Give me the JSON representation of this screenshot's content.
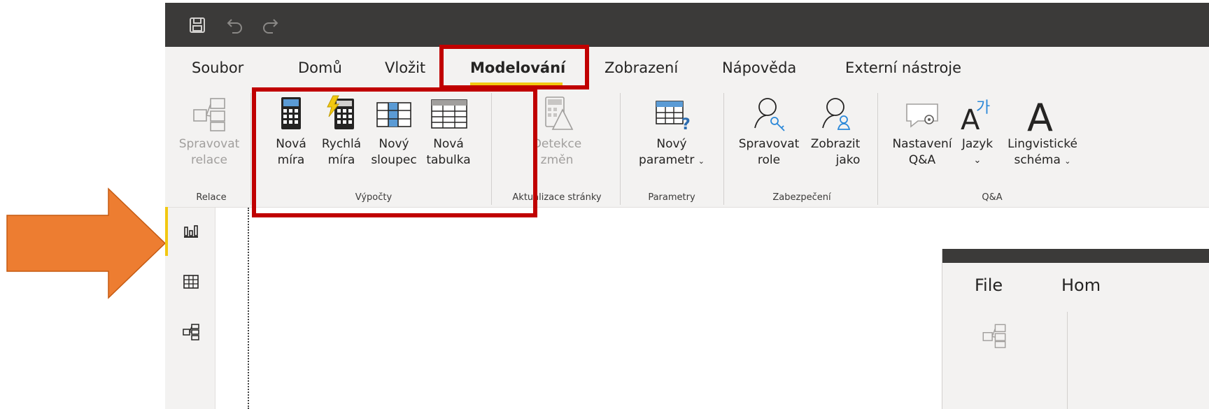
{
  "title_bar": {
    "icons": [
      "save-icon",
      "undo-icon",
      "redo-icon"
    ]
  },
  "menu": {
    "tabs": [
      "Soubor",
      "Domů",
      "Vložit",
      "Modelování",
      "Zobrazení",
      "Nápověda",
      "Externí nástroje"
    ],
    "active": "Modelování"
  },
  "ribbon": {
    "groups": [
      {
        "label": "Relace",
        "buttons": [
          {
            "line1": "Spravovat",
            "line2": "relace",
            "enabled": false
          }
        ]
      },
      {
        "label": "Výpočty",
        "buttons": [
          {
            "line1": "Nová",
            "line2": "míra",
            "enabled": true
          },
          {
            "line1": "Rychlá",
            "line2": "míra",
            "enabled": true
          },
          {
            "line1": "Nový",
            "line2": "sloupec",
            "enabled": true
          },
          {
            "line1": "Nová",
            "line2": "tabulka",
            "enabled": true
          }
        ]
      },
      {
        "label": "Aktualizace stránky",
        "buttons": [
          {
            "line1": "Detekce",
            "line2": "změn",
            "enabled": false
          }
        ]
      },
      {
        "label": "Parametry",
        "buttons": [
          {
            "line1": "Nový",
            "line2": "parametr",
            "enabled": true
          }
        ]
      },
      {
        "label": "Zabezpečení",
        "buttons": [
          {
            "line1": "Spravovat",
            "line2": "role",
            "enabled": true
          },
          {
            "line1": "Zobrazit",
            "line2": "jako",
            "enabled": true
          }
        ]
      },
      {
        "label": "Q&A",
        "buttons": [
          {
            "line1": "Nastavení",
            "line2": "Q&A",
            "enabled": true
          },
          {
            "line1": "Jazyk",
            "line2": "",
            "enabled": true
          },
          {
            "line1": "Lingvistické",
            "line2": "schéma",
            "enabled": true
          }
        ]
      }
    ]
  },
  "rail": {
    "items": [
      "report-view-icon",
      "data-view-icon",
      "model-view-icon"
    ],
    "active": "report-view-icon"
  },
  "inset": {
    "tabs": [
      "File",
      "Hom"
    ]
  },
  "colors": {
    "accent_yellow": "#f2c811",
    "highlight_red": "#c00000",
    "arrow_orange": "#ed7d31",
    "titlebar": "#3b3a39",
    "ribbon_bg": "#f3f2f1"
  }
}
